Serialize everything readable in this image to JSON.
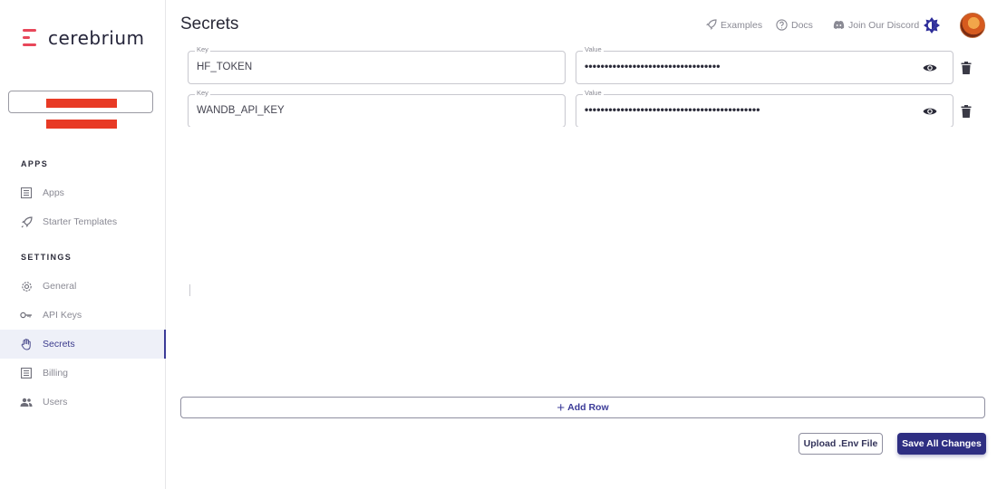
{
  "app": {
    "logo_text": "cerebrium",
    "logo_color": "#e8475a"
  },
  "header": {
    "title": "Secrets",
    "links": [
      {
        "label": "Examples",
        "icon": "rocket-icon"
      },
      {
        "label": "Docs",
        "icon": "help-circle-icon"
      },
      {
        "label": "Join Our Discord",
        "icon": "discord-icon"
      }
    ]
  },
  "sidebar": {
    "sections": [
      {
        "title": "APPS",
        "items": [
          {
            "label": "Apps",
            "icon": "apps-list-icon"
          },
          {
            "label": "Starter Templates",
            "icon": "rocket-icon"
          }
        ]
      },
      {
        "title": "SETTINGS",
        "items": [
          {
            "label": "General",
            "icon": "gear-icon"
          },
          {
            "label": "API Keys",
            "icon": "key-icon"
          },
          {
            "label": "Secrets",
            "icon": "hand-icon",
            "active": true
          },
          {
            "label": "Billing",
            "icon": "receipt-icon"
          },
          {
            "label": "Users",
            "icon": "users-icon"
          }
        ]
      }
    ]
  },
  "secrets": {
    "key_label": "Key",
    "value_label": "Value",
    "rows": [
      {
        "key": "HF_TOKEN",
        "value_masked": "••••••••••••••••••••••••••••••••••"
      },
      {
        "key": "WANDB_API_KEY",
        "value_masked": "••••••••••••••••••••••••••••••••••••••••••••"
      }
    ]
  },
  "actions": {
    "add_row": "Add Row",
    "upload_env": "Upload .Env File",
    "save_all": "Save All Changes"
  },
  "colors": {
    "accent": "#2e2e82",
    "redaction": "#e83a25"
  }
}
